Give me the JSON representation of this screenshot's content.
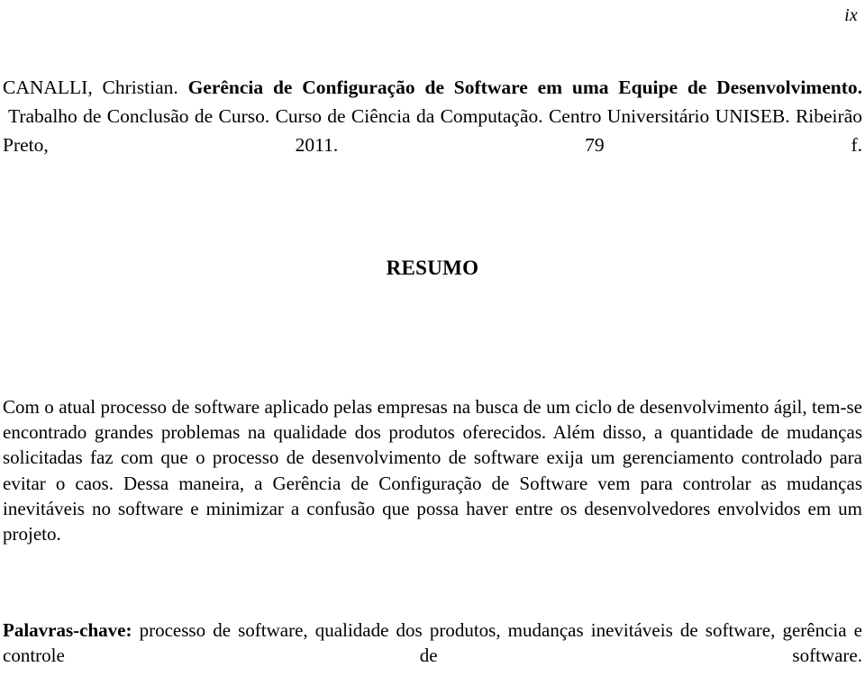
{
  "document": {
    "page_number": "ix",
    "language": "pt-BR",
    "background_color": "#ffffff",
    "text_color": "#000000"
  },
  "citation": {
    "author": "CANALLI, Christian.",
    "title_bold": "Gerência de Configuração de Software em uma Equipe de Desenvolvimento.",
    "rest": "Trabalho de Conclusão de Curso. Curso de Ciência da Computação. Centro Universitário UNISEB. Ribeirão Preto, 2011. 79 f."
  },
  "section": {
    "heading": "RESUMO"
  },
  "abstract": {
    "paragraphs": [
      "Com o atual processo de software aplicado pelas empresas na busca de um ciclo de desenvolvimento ágil, tem-se encontrado grandes problemas na qualidade dos produtos oferecidos. Além disso, a quantidade de mudanças solicitadas faz com que o processo de desenvolvimento de software exija um gerenciamento controlado para evitar o caos.",
      "Dessa maneira, a Gerência de Configuração de Software vem para controlar as mudanças inevitáveis no software e minimizar a confusão que possa haver entre os desenvolvedores envolvidos em um projeto."
    ],
    "full_text": "Com o atual processo de software aplicado pelas empresas na busca de um ciclo de desenvolvimento ágil, tem-se encontrado grandes problemas na qualidade dos produtos oferecidos. Além disso, a quantidade de mudanças solicitadas faz com que o processo de desenvolvimento de software exija um gerenciamento controlado para evitar o caos. Dessa maneira, a Gerência de Configuração de Software vem para controlar as mudanças inevitáveis no software e minimizar a confusão que possa haver entre os desenvolvedores envolvidos em um projeto."
  },
  "keywords": {
    "label": "Palavras-chave:",
    "text": "processo de software, qualidade dos produtos, mudanças inevitáveis de software, gerência e controle de software.",
    "terms": [
      "processo de software",
      "qualidade dos produtos",
      "mudanças inevitáveis de software",
      "gerência e controle de software"
    ]
  }
}
